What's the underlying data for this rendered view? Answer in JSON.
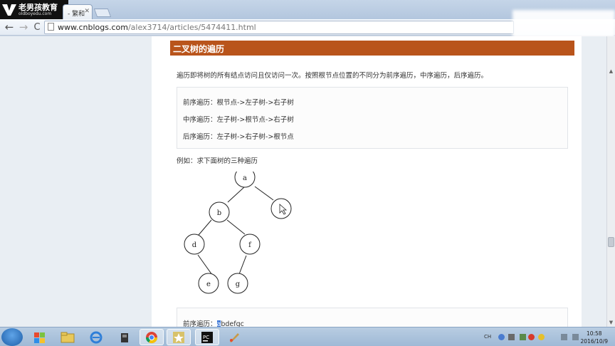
{
  "watermark": {
    "title": "老男孩教育",
    "subtitle": "oldboyedu.com"
  },
  "browser": {
    "tab_title": "- 繁和",
    "url_host": "www.cnblogs.com",
    "url_path": "/alex3714/articles/5474411.html"
  },
  "article": {
    "section_title": "二叉树的遍历",
    "intro": "遍历即将树的所有结点访问且仅访问一次。按照根节点位置的不同分为前序遍历，中序遍历，后序遍历。",
    "traversals": [
      "前序遍历：根节点->左子树->右子树",
      "中序遍历：左子树->根节点->右子树",
      "后序遍历：左子树->右子树->根节点"
    ],
    "example": "例如：求下面树的三种遍历",
    "tree_nodes": [
      "a",
      "b",
      "c",
      "d",
      "f",
      "e",
      "g"
    ],
    "answer_label": "前序遍历：",
    "answer_selected": "a",
    "answer_rest": "bdefgc"
  },
  "taskbar": {
    "ime": "CH",
    "time": "10:58",
    "date": "2016/10/9"
  },
  "colors": {
    "section_bg": "#b9541b",
    "selection": "#3a75d6"
  }
}
